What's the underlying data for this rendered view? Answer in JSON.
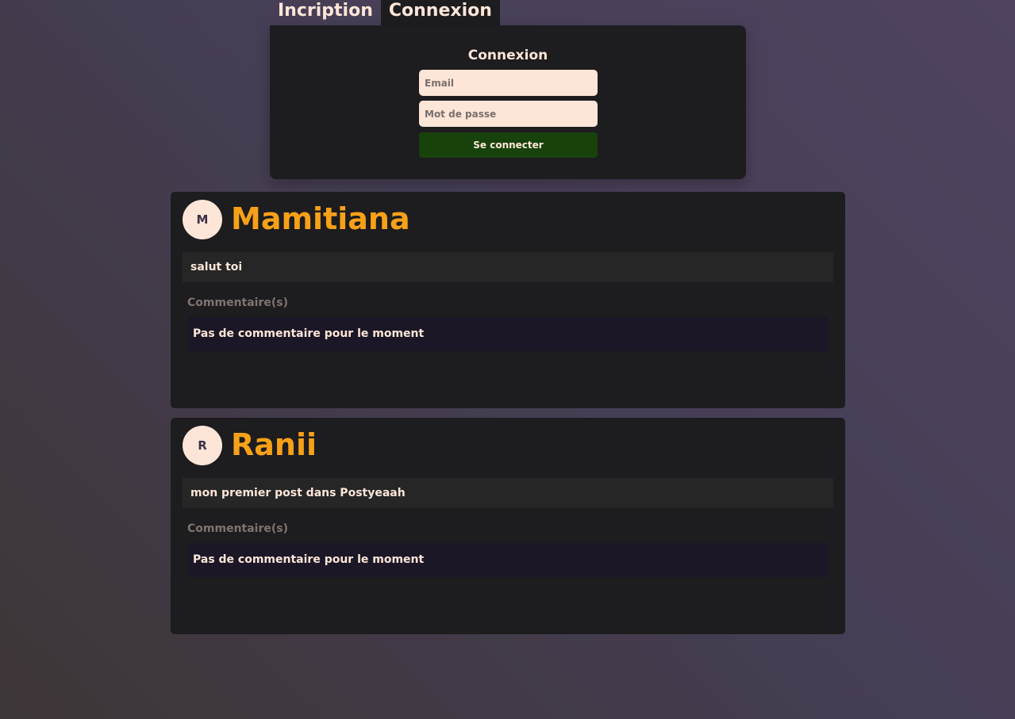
{
  "tabs": [
    {
      "label": "Incription",
      "active": false
    },
    {
      "label": "Connexion",
      "active": true
    }
  ],
  "login": {
    "title": "Connexion",
    "email_placeholder": "Email",
    "email_value": "",
    "password_placeholder": "Mot de passe",
    "password_value": "",
    "submit_label": "Se connecter"
  },
  "posts": [
    {
      "avatar_initial": "M",
      "author": "Mamitiana",
      "content": "salut toi",
      "comments_label": "Commentaire(s)",
      "empty_comments": "Pas de commentaire pour le moment"
    },
    {
      "avatar_initial": "R",
      "author": "Ranii",
      "content": "mon premier post dans Postyeaah",
      "comments_label": "Commentaire(s)",
      "empty_comments": "Pas de commentaire pour le moment"
    }
  ],
  "colors": {
    "panel": "#1d1c1f",
    "author": "#f7a118",
    "button": "#18420b",
    "input": "#fde5d7"
  }
}
